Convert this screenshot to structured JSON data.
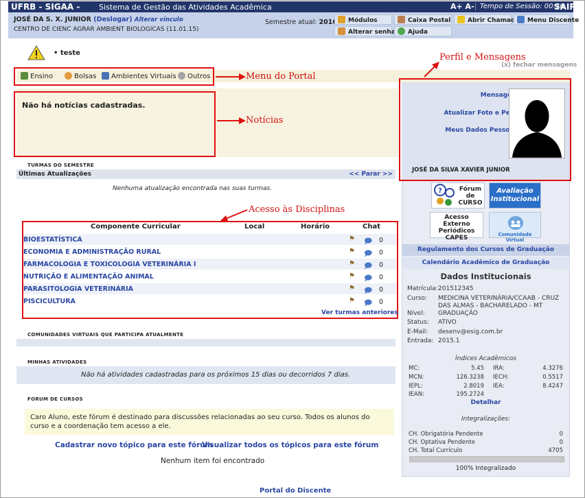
{
  "topbar": {
    "brand": "UFRB - SIGAA -",
    "system": "Sistema de Gestão das Atividades Acadêmica",
    "font_size": "A+ A-",
    "session": "Tempo de Sessão: 00:30",
    "logout": "SAIR"
  },
  "user": {
    "name": "JOSÉ DA S. X. JUNIOR",
    "logout_link": "(Deslogar)",
    "change_link": "Alterar vínculo",
    "unit": "CENTRO DE CIENC AGRAR AMBIENT BIOLOGICAS (11.01.15)",
    "semester_label": "Semestre atual:",
    "semester_value": "2016.1"
  },
  "quick_buttons": {
    "modulos": "Módulos",
    "caixa_postal": "Caixa Postal",
    "abrir_chamado": "Abrir Chamado",
    "menu_discente": "Menu Discente",
    "alterar_senha": "Alterar senha",
    "ajuda": "Ajuda"
  },
  "alert": {
    "message": "• teste",
    "close": "(x) fechar mensagens"
  },
  "menu": {
    "items": [
      "Ensino",
      "Bolsas",
      "Ambientes Virtuais",
      "Outros"
    ]
  },
  "annotations": {
    "menu_portal": "Menu do Portal",
    "noticias": "Notícias",
    "acesso": "Acesso às Disciplinas",
    "perfil": "Perfil e Mensagens"
  },
  "news": {
    "empty": "Não há notícias cadastradas."
  },
  "turmas": {
    "section_title": "Turmas do Semestre",
    "updates_title": "Últimas Atualizações",
    "stop": "<< Parar >>",
    "no_updates": "Nenhuma atualização encontrada nas suas turmas.",
    "headers": {
      "componente": "Componente Curricular",
      "local": "Local",
      "horario": "Horário",
      "chat": "Chat"
    },
    "rows": [
      {
        "name": "BIOESTATÍSTICA",
        "chat": "0"
      },
      {
        "name": "ECONOMIA E ADMINISTRAÇÃO RURAL",
        "chat": "0"
      },
      {
        "name": "FARMACOLOGIA E TOXICOLOGIA VETERINÁRIA I",
        "chat": "0"
      },
      {
        "name": "NUTRIÇÃO E ALIMENTAÇÃO ANIMAL",
        "chat": "0"
      },
      {
        "name": "PARASITOLOGIA VETERINÁRIA",
        "chat": "0"
      },
      {
        "name": "PISCICULTURA",
        "chat": "0"
      }
    ],
    "previous": "Ver turmas anteriores"
  },
  "comunidades": {
    "title": "Comunidades Virtuais que participa atualmente"
  },
  "atividades": {
    "title": "Minhas atividades",
    "empty": "Não há atividades cadastradas para os próximos 15 dias ou decorridos 7 dias."
  },
  "forum": {
    "title": "Forum de Cursos",
    "message": "Caro Aluno, este fórum é destinado para discussões relacionadas ao seu curso. Todos os alunos do curso e a coordenação tem acesso a ele.",
    "new_topic": "Cadastrar novo tópico para este fórum",
    "view_all": "Visualizar todos os tópicos para este fórum",
    "empty": "Nenhum item foi encontrado"
  },
  "footer": {
    "link": "Portal do Discente"
  },
  "profile": {
    "messages": "Mensagens",
    "update_photo": "Atualizar Foto e Perfil",
    "my_data": "Meus Dados Pessoais",
    "full_name": "JOSÉ DA SILVA XAVIER JUNIOR"
  },
  "logos": {
    "forum": "Fórum de CURSO",
    "avaliacao": "Avaliação Institucional",
    "capes": "Acesso Externo Periódicos CAPES",
    "comunidade": "Comunidade Virtual"
  },
  "side_links": {
    "regulamento": "Regulamento dos Cursos de Graduação",
    "calendario": "Calendário Acadêmico de Graduação"
  },
  "institutional": {
    "title": "Dados Institucionais",
    "matricula_label": "Matrícula:",
    "matricula": "201512345",
    "curso_label": "Curso:",
    "curso": "MEDICINA VETERINÁRIA/CCAAB - CRUZ DAS ALMAS - BACHARELADO - MT",
    "nivel_label": "Nível:",
    "nivel": "GRADUAÇÃO",
    "status_label": "Status:",
    "status": "ATIVO",
    "email_label": "E-Mail:",
    "email": "desenv@esig.com.br",
    "entrada_label": "Entrada:",
    "entrada": "2015.1"
  },
  "indices": {
    "title": "Índices Acadêmicos",
    "mc_label": "MC:",
    "mc": "5.45",
    "ira_label": "IRA:",
    "ira": "4.3276",
    "mcn_label": "MCN:",
    "mcn": "126.3238",
    "iech_label": "IECH:",
    "iech": "0.5517",
    "iepl_label": "IEPL:",
    "iepl": "2.8019",
    "iea_label": "IEA:",
    "iea": "8.4247",
    "iean_label": "IEAN:",
    "iean": "195.2724",
    "detail": "Detalhar"
  },
  "integralizacoes": {
    "title": "Integralizações:",
    "obrig_label": "CH. Obrigatória Pendente",
    "obrig": "0",
    "opt_label": "CH. Optativa Pendente",
    "opt": "0",
    "total_label": "CH. Total Currículo",
    "total": "4705",
    "progress": 1.0,
    "progress_label": "100% Integralizado"
  },
  "colors": {
    "header": "#22356a",
    "link": "#2a47a3",
    "annotation": "#e01010"
  }
}
